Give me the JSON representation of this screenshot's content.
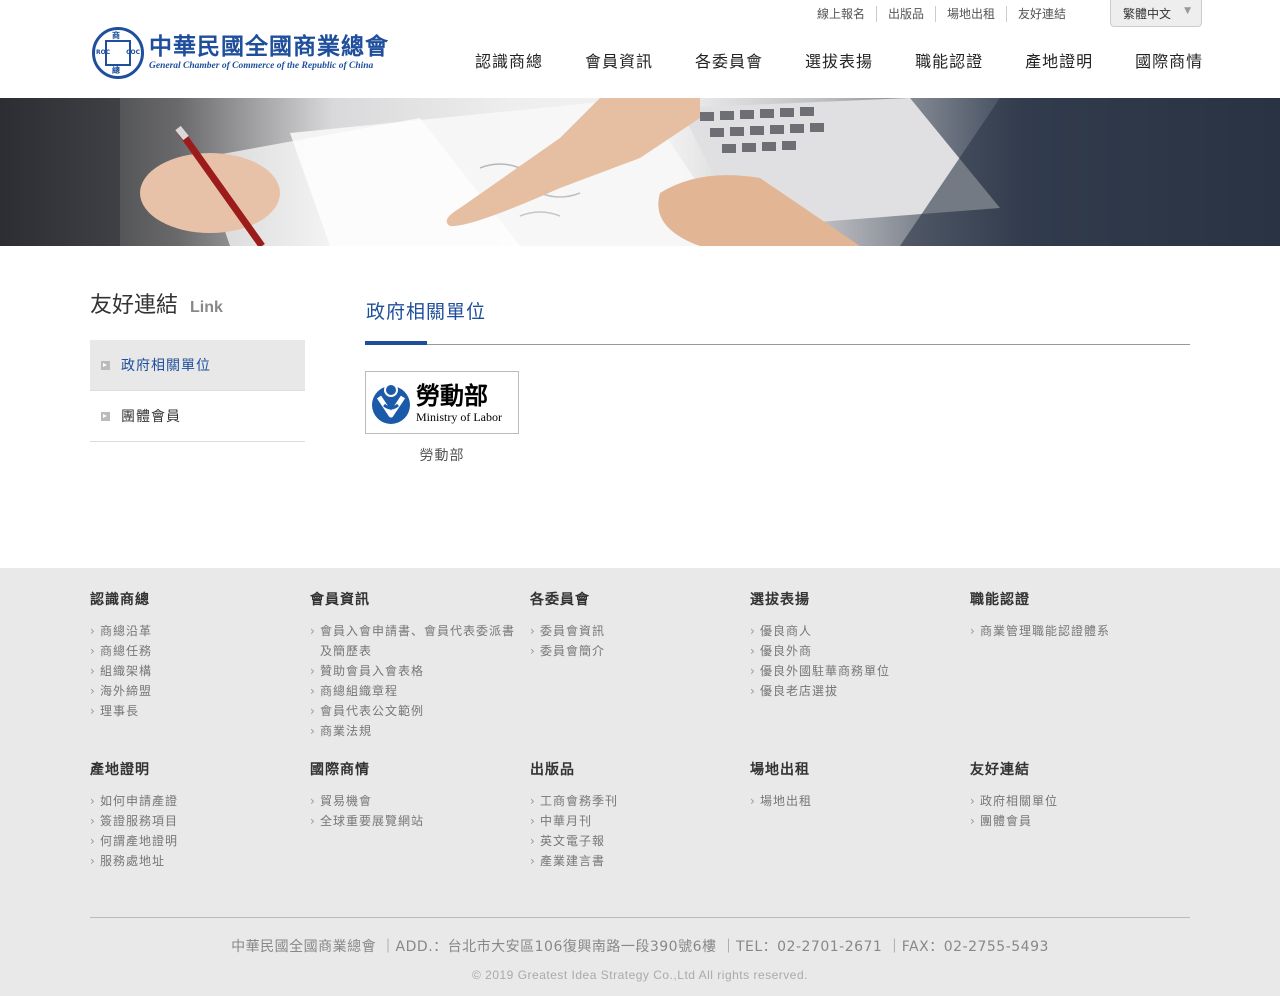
{
  "header": {
    "logo_cn": "中華民國全國商業總會",
    "logo_en": "General Chamber of Commerce of the Republic of China",
    "seal": {
      "top": "商",
      "bottom": "總",
      "left": "ROC",
      "right": "COC"
    },
    "top_links": [
      "線上報名",
      "出版品",
      "場地出租",
      "友好連結"
    ],
    "language": "繁體中文",
    "nav": [
      "認識商總",
      "會員資訊",
      "各委員會",
      "選拔表揚",
      "職能認證",
      "產地證明",
      "國際商情"
    ]
  },
  "sidebar": {
    "title": "友好連結",
    "title_en": "Link",
    "items": [
      {
        "label": "政府相關單位",
        "active": true
      },
      {
        "label": "團體會員",
        "active": false
      }
    ]
  },
  "content": {
    "title": "政府相關單位",
    "links": [
      {
        "logo_cn": "勞動部",
        "logo_en": "Ministry of Labor",
        "name": "勞動部"
      }
    ]
  },
  "footer": {
    "columns": [
      {
        "title": "認識商總",
        "items": [
          "商總沿革",
          "商總任務",
          "組織架構",
          "海外締盟",
          "理事長"
        ]
      },
      {
        "title": "會員資訊",
        "items": [
          "會員入會申請書、會員代表委派書",
          "及簡歷表",
          "贊助會員入會表格",
          "商總組織章程",
          "會員代表公文範例",
          "商業法規"
        ]
      },
      {
        "title": "各委員會",
        "items": [
          "委員會資訊",
          "委員會簡介"
        ]
      },
      {
        "title": "選拔表揚",
        "items": [
          "優良商人",
          "優良外商",
          "優良外國駐華商務單位",
          "優良老店選拔"
        ]
      },
      {
        "title": "職能認證",
        "items": [
          "商業管理職能認證體系"
        ]
      },
      {
        "title": "產地證明",
        "items": [
          "如何申請產證",
          "簽證服務項目",
          "何謂產地證明",
          "服務處地址"
        ]
      },
      {
        "title": "國際商情",
        "items": [
          "貿易機會",
          "全球重要展覽網站"
        ]
      },
      {
        "title": "出版品",
        "items": [
          "工商會務季刊",
          "中華月刊",
          "英文電子報",
          "產業建言書"
        ]
      },
      {
        "title": "場地出租",
        "items": [
          "場地出租"
        ]
      },
      {
        "title": "友好連結",
        "items": [
          "政府相關單位",
          "團體會員"
        ]
      }
    ],
    "info": "中華民國全國商業總會 ｜ADD.：台北市大安區106復興南路一段390號6樓 ｜TEL：02-2701-2671 ｜FAX：02-2755-5493",
    "copyright": "© 2019 Greatest Idea Strategy Co.,Ltd All rights reserved."
  },
  "colors": {
    "brand": "#1f4f9c",
    "footer_bg": "#e9e9e9"
  }
}
